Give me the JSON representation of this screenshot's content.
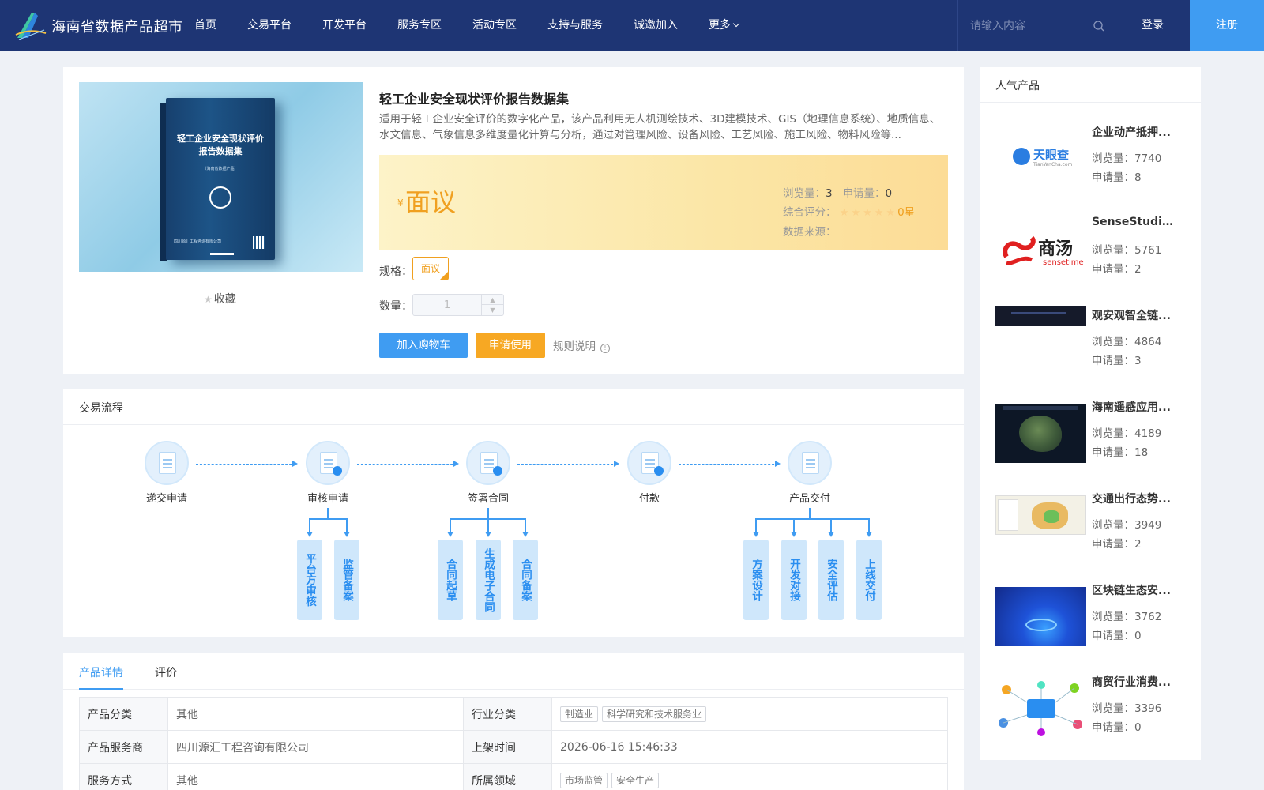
{
  "header": {
    "site_title": "海南省数据产品超市",
    "nav": [
      "首页",
      "交易平台",
      "开发平台",
      "服务专区",
      "活动专区",
      "支持与服务",
      "诚邀加入",
      "更多"
    ],
    "search_placeholder": "请输入内容",
    "login": "登录",
    "register": "注册"
  },
  "product": {
    "title": "轻工企业安全现状评价报告数据集",
    "description": "适用于轻工企业安全评价的数字化产品，该产品利用无人机测绘技术、3D建模技术、GIS（地理信息系统）、地质信息、水文信息、气象信息多维度量化计算与分析，通过对管理风险、设备风险、工艺风险、施工风险、物料风险等...",
    "image_book_title": "轻工企业安全现状评价报告数据集",
    "image_book_subtitle": "（海南省数据产品）",
    "image_book_company": "四川源汇工程咨询有限公司",
    "favorite": "收藏",
    "price_symbol": "¥",
    "price": "面议",
    "views_label": "浏览量：",
    "views": "3",
    "applies_label": "申请量：",
    "applies": "0",
    "rating_label": "综合评分：",
    "rating_text": "0星",
    "rating_stars": 0,
    "source_label": "数据来源：",
    "source": "",
    "spec_label": "规格：",
    "spec_value": "面议",
    "qty_label": "数量：",
    "qty_value": "1",
    "add_cart": "加入购物车",
    "apply": "申请使用",
    "rules": "规则说明"
  },
  "flow": {
    "title": "交易流程",
    "steps": [
      "递交申请",
      "审核申请",
      "签署合同",
      "付款",
      "产品交付"
    ],
    "review_subs": [
      "平台方审核",
      "监管备案"
    ],
    "contract_subs": [
      "合同起草",
      "生成电子合同",
      "合同备案"
    ],
    "delivery_subs": [
      "方案设计",
      "开发对接",
      "安全评估",
      "上线交付"
    ]
  },
  "details": {
    "tabs": [
      "产品详情",
      "评价"
    ],
    "rows": [
      {
        "k1": "产品分类",
        "v1": "其他",
        "k2": "行业分类",
        "tags2": [
          "制造业",
          "科学研究和技术服务业"
        ]
      },
      {
        "k1": "产品服务商",
        "v1": "四川源汇工程咨询有限公司",
        "k2": "上架时间",
        "v2": "2026-06-16 15:46:33"
      },
      {
        "k1": "服务方式",
        "v1": "其他",
        "k2": "所属领域",
        "tags2": [
          "市场监管",
          "安全生产"
        ]
      }
    ]
  },
  "popular": {
    "title": "人气产品",
    "items": [
      {
        "name": "企业动产抵押...",
        "views": "浏览量：7740",
        "applies": "申请量：8",
        "thumb": "tianyancha"
      },
      {
        "name": "SenseStudio...",
        "views": "浏览量：5761",
        "applies": "申请量：2",
        "thumb": "sensetime"
      },
      {
        "name": "观安观智全链...",
        "views": "浏览量：4864",
        "applies": "申请量：3",
        "thumb": "dark-dashboard"
      },
      {
        "name": "海南遥感应用...",
        "views": "浏览量：4189",
        "applies": "申请量：18",
        "thumb": "satellite-map"
      },
      {
        "name": "交通出行态势...",
        "views": "浏览量：3949",
        "applies": "申请量：2",
        "thumb": "traffic-map"
      },
      {
        "name": "区块链生态安...",
        "views": "浏览量：3762",
        "applies": "申请量：0",
        "thumb": "blockchain"
      },
      {
        "name": "商贸行业消费...",
        "views": "浏览量：3396",
        "applies": "申请量：0",
        "thumb": "network-diagram"
      }
    ],
    "thumb_text_tianyancha": "天眼查",
    "thumb_text_tianyancha_sub": "TianYanCha.com",
    "thumb_text_sensetime": "商汤",
    "thumb_text_sensetime_sub": "sensetime"
  },
  "colors": {
    "header": "#1e3574",
    "accent": "#3f9cf2",
    "orange": "#f0a020"
  }
}
